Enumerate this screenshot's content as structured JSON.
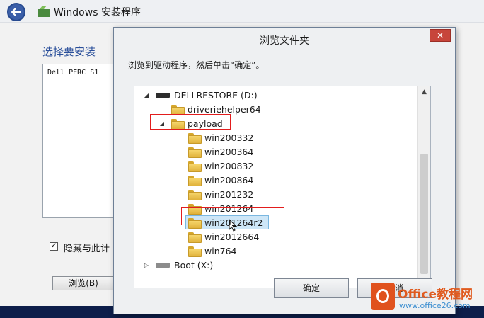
{
  "setup": {
    "title": "Windows 安装程序",
    "heading": "选择要安装",
    "driver_item": "Dell PERC S1",
    "hide_label": "隐藏与此计",
    "hide_checked": true,
    "check_mark": "✔",
    "browse_label": "浏览(B)"
  },
  "dialog": {
    "title": "浏览文件夹",
    "close_label": "✕",
    "instruction": "浏览到驱动程序，然后单击“确定”。",
    "tree": [
      {
        "label": "DELLRESTORE (D:)",
        "type": "drive",
        "expander": "◢"
      },
      {
        "label": "driveriehelper64",
        "type": "folder",
        "expander": ""
      },
      {
        "label": "payload",
        "type": "folder",
        "expander": "◢"
      },
      {
        "label": "win200332",
        "type": "folder",
        "expander": ""
      },
      {
        "label": "win200364",
        "type": "folder",
        "expander": ""
      },
      {
        "label": "win200832",
        "type": "folder",
        "expander": ""
      },
      {
        "label": "win200864",
        "type": "folder",
        "expander": ""
      },
      {
        "label": "win201232",
        "type": "folder",
        "expander": ""
      },
      {
        "label": "win201264",
        "type": "folder",
        "expander": ""
      },
      {
        "label": "win201264r2",
        "type": "folder",
        "expander": "",
        "selected": true
      },
      {
        "label": "win2012664",
        "type": "folder",
        "expander": ""
      },
      {
        "label": "win764",
        "type": "folder",
        "expander": ""
      },
      {
        "label": "Boot (X:)",
        "type": "drive",
        "expander": "▷"
      }
    ],
    "ok_label": "确定",
    "cancel_label": "取消"
  },
  "watermark": {
    "brand": "Office教程网",
    "url": "www.office26.com"
  },
  "colors": {
    "highlight_box": "#e21d1d",
    "selection": "#cde6f7",
    "accent_blue": "#2a4f9a"
  },
  "icons": [
    "back-arrow-icon",
    "setup-app-icon",
    "drive-icon",
    "folder-icon",
    "expand-triangle-icon",
    "scroll-up-icon",
    "scroll-down-icon",
    "mouse-cursor-icon"
  ]
}
